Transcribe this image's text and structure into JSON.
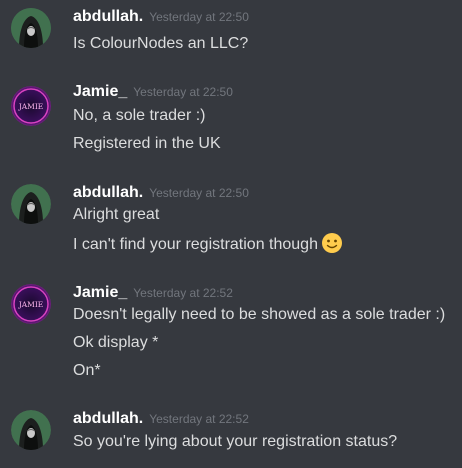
{
  "messages": [
    {
      "author": "abdullah.",
      "timestamp": "Yesterday at 22:50",
      "avatar": "dark-hooded-avatar",
      "lines": [
        "Is ColourNodes an LLC?"
      ]
    },
    {
      "author": "Jamie_",
      "timestamp": "Yesterday at 22:50",
      "avatar": "neon-jamie-avatar",
      "avatar_text": "JAMIE",
      "lines": [
        "No, a sole trader :)",
        "Registered in the UK"
      ]
    },
    {
      "author": "abdullah.",
      "timestamp": "Yesterday at 22:50",
      "avatar": "dark-hooded-avatar",
      "lines": [
        "Alright great",
        "I can't find your registration though"
      ],
      "emoji": "slightly-smiling-face"
    },
    {
      "author": "Jamie_",
      "timestamp": "Yesterday at 22:52",
      "avatar": "neon-jamie-avatar",
      "avatar_text": "JAMIE",
      "lines": [
        "Doesn't legally need to be showed as a sole trader :)",
        "Ok display *",
        "On*"
      ]
    },
    {
      "author": "abdullah.",
      "timestamp": "Yesterday at 22:52",
      "avatar": "dark-hooded-avatar",
      "lines": [
        "So you're lying about your registration status?"
      ]
    }
  ],
  "colors": {
    "background": "#36393f",
    "username": "#ffffff",
    "timestamp": "#72767d",
    "message_text": "#dcddde"
  }
}
